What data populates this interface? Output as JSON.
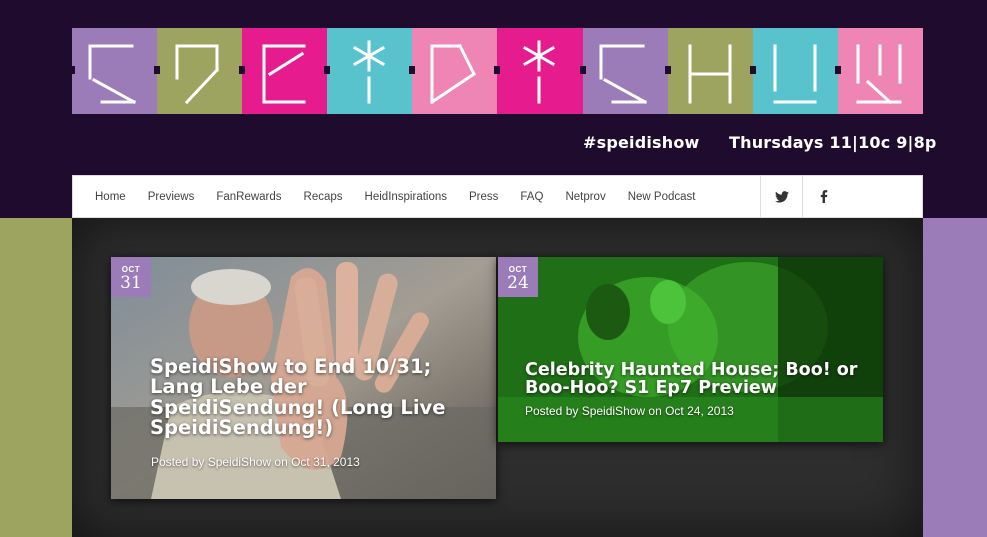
{
  "logo": {
    "text": "SPEIDISHOW",
    "tiles": [
      {
        "letter": "S",
        "color": "#9b7bb8"
      },
      {
        "letter": "P",
        "color": "#9ca460"
      },
      {
        "letter": "E",
        "color": "#e61b8e"
      },
      {
        "letter": "*",
        "color": "#58c3cd"
      },
      {
        "letter": "D",
        "color": "#ef85b4"
      },
      {
        "letter": "*",
        "color": "#e61b8e"
      },
      {
        "letter": "S",
        "color": "#9b7bb8"
      },
      {
        "letter": "H",
        "color": "#9ca460"
      },
      {
        "letter": "O",
        "color": "#58c3cd"
      },
      {
        "letter": "W",
        "color": "#ef85b4"
      }
    ]
  },
  "tagline": {
    "hashtag": "#speidishow",
    "schedule": "Thursdays 11|10c 9|8p"
  },
  "nav": {
    "items": [
      "Home",
      "Previews",
      "FanRewards",
      "Recaps",
      "HeidInspirations",
      "Press",
      "FAQ",
      "Netprov",
      "New Podcast"
    ],
    "twitter_icon": "twitter-icon",
    "facebook_icon": "facebook-icon"
  },
  "posts": [
    {
      "month": "OCT",
      "day": "31",
      "title": "SpeidiShow to End 10/31; Lang Lebe der SpeidiSendung! (Long Live SpeidiSendung!)",
      "meta": "Posted by SpeidiShow on Oct 31, 2013"
    },
    {
      "month": "OCT",
      "day": "24",
      "title": "Celebrity Haunted House; Boo! or Boo-Hoo? S1 Ep7 Preview",
      "meta": "Posted by SpeidiShow on Oct 24, 2013"
    }
  ],
  "colors": {
    "header_bg": "#1e0b2d",
    "purple": "#9b7bb8",
    "olive": "#9ca460",
    "magenta": "#e61b8e",
    "teal": "#58c3cd",
    "pink": "#ef85b4"
  }
}
